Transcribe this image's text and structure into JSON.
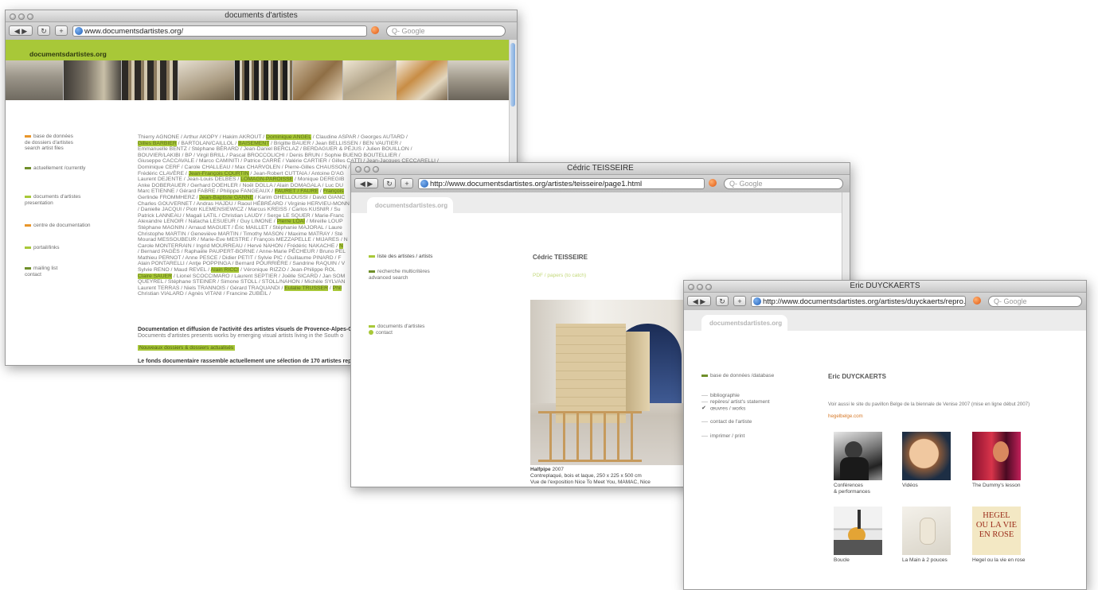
{
  "window1": {
    "title": "documents d'artistes",
    "url": "www.documentsdartistes.org/",
    "search_placeholder": "Q- Google",
    "logo": "documentsdartistes.org",
    "nav": [
      {
        "label": "base de données\nde dossiers d'artistes\nsearch artist files",
        "color": "#e8962b"
      },
      {
        "label": "actuellement /currently",
        "color": "#6f8f2a"
      },
      {
        "label": "documents d'artistes\npresentation",
        "color": "#a8c838"
      },
      {
        "label": "centre de documentation",
        "color": "#e8962b"
      },
      {
        "label": "portail/links",
        "color": "#a8c838"
      },
      {
        "label": "mailing list\ncontact",
        "color": "#6f8f2a"
      }
    ],
    "intro_bold": "Documentation et diffusion de l'activité des artistes visuels de Provence-Alpes-Côte",
    "intro_sub": "Documents d'artistes presents works by emerging visual artists living in the South o",
    "new_label": "Nouveaux dossiers & dossiers actualisés",
    "fonds": "Le fonds documentaire rassemble actuellement une sélection de 170 artistes repré"
  },
  "artists_lines": [
    [
      "Thierry AGNONE / Arthur AKOPY / Hakim AKROUT / ",
      {
        "hl": "Dominique ANGEL"
      },
      " / Claudine ASPAR / Georges AUTARD /"
    ],
    [
      {
        "hl": "Gilles BARBIER"
      },
      " / BARTOLAN/CAILLOL / ",
      {
        "hl": "BAISEMENT"
      },
      " / Brigitte BAUER / Jean BELLISSEN / BEN VAUTIER /"
    ],
    [
      "Emmanuelle BENTZ / Stéphane BÉRARD / Jean-Daniel BERCLAZ / BERDAGUER & PÉJUS / Julien BOUILLON /"
    ],
    [
      "BOUVIER/LAKIBI / BP / Virgil BRILL / Pascal BROCCOLICHI / Denis BRUN / Sophie BUENO BOUTELLIER /"
    ],
    [
      "Giuseppe CACCAVALE / Marco CAMINITI / Patrice CARRÉ / Valérie CARTIER / Gilles CATTI / Jean-Jacques CECCARELLI /"
    ],
    [
      "Dominique CERF / Carole CHALLEAU / Max CHARVOLEN / Pierre-Gilles CHAUSSON /"
    ],
    [
      "Frédéric CLAVÈRE / ",
      {
        "hl": "Jean-François COURTIN"
      },
      " / Jean-Robert CUTTAIA / Antoine D'AG"
    ],
    [
      "Laurent DEJENTE / Jean-Louis DELBÈS / ",
      {
        "hl": "LOMAGN-PAROISSE"
      },
      " / Monique DEREGIB"
    ],
    [
      "Anke DOBERAUER / Gerhard DOEHLER / Noël DOLLA / Alain DOMAGALA / Luc DU"
    ],
    [
      "Marc ETIENNE / Gérard FABRE / Philippe FANGEAUX / ",
      {
        "hl": "FAURET / FAURE"
      },
      " / ",
      {
        "hl": "François"
      }
    ],
    [
      "Gerlinde FROMMHERZ / ",
      {
        "hl": "Jean-Baptiste GANNE"
      },
      " / Karim GHELLOUSSI / David GIANC"
    ],
    [
      "Charles GOUVERNET / Andras HAJDU / Raoul HÉBRÉARD / Virginie HERVIEU-MONN"
    ],
    [
      "/ Danielle JACQUI / Piotr KLEMENSIEWICZ / Marcus KREISS / Carlos KUSNIR / Su"
    ],
    [
      "Patrick LANNEAU / Magali LATIL / Christian LAUDY / Serge LE SQUER / Marie-Franc"
    ],
    [
      "Alexandre LENOIR / Natacha LESUEUR / Guy LIMONE / ",
      {
        "hl": "Pierre LOAÏ"
      },
      " / Mireille LOUP"
    ],
    [
      "Stéphane MAGNIN / Arnaud MAGUET / Éric MAILLET / Stéphanie MAJORAL / Laure"
    ],
    [
      "Christophe MARTIN / Geneviève MARTIN / Timothy MASON / Maxime MATRAY / Sté"
    ],
    [
      "Mourad MESSOUBEUR / Marie-Eve MESTRE / François MEZZAPELLE / MIJARES / N"
    ],
    [
      "Carole MONTERRAIN / Ingrid MOURREAU / Hervé NAHON / Frédéric NAKACHE / ",
      {
        "hl": "N"
      }
    ],
    [
      "/ Bernard PAGÈS / Raphaële PAUPERT-BORNE / Anne-Marie PÊCHEUR / Bruno PEL"
    ],
    [
      "Mathieu PERNOT / Anne PESCE / Didier PETIT / Sylvie PIC / Guillaume PINARD / F"
    ],
    [
      "Alain PONTARELLI / Antje POPPINGA / Bernard POURRIÈRE / Sandrine RAQUIN / V"
    ],
    [
      "Sylvie RENO / Maud REVEL / ",
      {
        "hl": "Alain RICCI"
      },
      " / Véronique RIZZO / Jean-Philippe ROL"
    ],
    [
      {
        "hl": "Claire SAUER"
      },
      " / Lionel SCOCCIMARO / Laurent SEPTIER / Joëlle SICARD / Jan SOM"
    ],
    [
      "QUEYREL / Stéphane STEINER / Simone STOLL / STOLL/NAHON / Michèle SYLVAN"
    ],
    [
      "Laurent TERRAS / Niels TRANNOIS / Gérard TRAQUANDI / ",
      {
        "hl": "Eulalie TRUSSER"
      },
      " / ",
      {
        "hl": "Phil"
      }
    ],
    [
      "Christian VIALARD / Agnès VITANI / Francine ZUBEIL /"
    ]
  ],
  "window2": {
    "title": "Cédric TEISSEIRE",
    "url": "http://www.documentsdartistes.org/artistes/teisseire/page1.html",
    "search_placeholder": "Q- Google",
    "logo": "documentsdartistes.org",
    "nav1": "liste des artistes / artists",
    "nav2": "recherche multicritères\nadvanced search",
    "nav3": "documents d'artistes",
    "nav4": "contact",
    "artist": "Cédric TEISSEIRE",
    "link": "PDF / papers (to catch)",
    "caption_title": "Halfpipe",
    "caption_year": "2007",
    "caption_line1": "Contreplaqué, bois et laque, 250 x 225 x 500 cm",
    "caption_line2": "Vue de l'exposition Nice To Meet You, MAMAC, Nice"
  },
  "window3": {
    "title": "Eric DUYCKAERTS",
    "url": "http://www.documentsdartistes.org/artistes/duyckaerts/repro.html",
    "search_placeholder": "Q- Google",
    "logo": "documentsdartistes.org",
    "nav_top": "base de données /database",
    "nav_links": [
      "bibliographie",
      "repères/ artist's statement",
      "œuvres / works"
    ],
    "nav_contact": "contact de l'artiste",
    "nav_imprimer": "imprimer / print",
    "artist": "Eric DUYCKAERTS",
    "note": "Voir aussi le site du pavillon Belge de la biennale de Venise 2007 (mise en ligne début 2007)",
    "note_link": "hegelbelge.com",
    "thumbs": [
      "Conférences\n& performances",
      "Vidéos",
      "The Dummy's lesson",
      "Boucle",
      "La Main à 2 pouces",
      "Hegel ou la vie en rose"
    ],
    "hegel_text": "HEGEL\nOU LA VIE\nEN ROSE"
  },
  "colors": {
    "green": "#a8c838",
    "orange": "#e8962b",
    "darkgreen": "#6f8f2a"
  }
}
